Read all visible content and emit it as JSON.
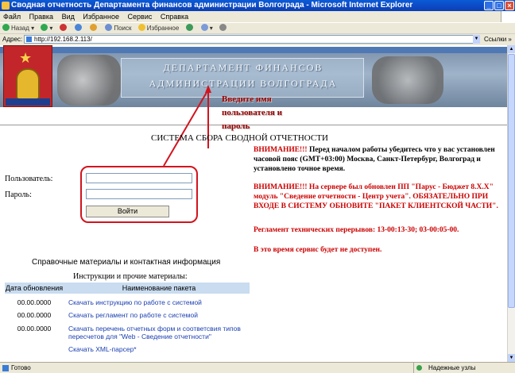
{
  "window": {
    "title": "Сводная отчетность Департамента финансов администрации Волгограда - Microsoft Internet Explorer"
  },
  "menu": [
    "Файл",
    "Правка",
    "Вид",
    "Избранное",
    "Сервис",
    "Справка"
  ],
  "toolbar": {
    "back": "Назад",
    "search": "Поиск",
    "favorites": "Избранное"
  },
  "address": {
    "label": "Адрес:",
    "url": "http://192.168.2.113/",
    "links": "Ссылки"
  },
  "banner": {
    "line1": "ДЕПАРТАМЕНТ ФИНАНСОВ",
    "line2": "АДМИНИСТРАЦИИ ВОЛГОГРАДА"
  },
  "callout": "Введите имя пользователя и пароль",
  "system_title": "СИСТЕМА СБОРА СВОДНОЙ ОТЧЕТНОСТИ",
  "login": {
    "user_label": "Пользователь:",
    "pass_label": "Пароль:",
    "user_value": "",
    "pass_value": "",
    "submit": "Войти"
  },
  "notices": {
    "n1_prefix": "ВНИМАНИЕ!!!",
    "n1_text": " Перед началом работы убедитесь что у вас установлен часовой пояс (GMT+03:00) Москва, Санкт-Петербург, Волгоград и установлено точное время.",
    "n2": "ВНИМАНИЕ!!! На сервере был обновлен ПП \"Парус - Бюджет 8.Х.Х\" модуль \"Сведение отчетности - Центр учета\". ОБЯЗАТЕЛЬНО ПРИ ВХОДЕ В СИСТЕМУ ОБНОВИТЕ \"ПАКЕТ КЛИЕНТСКОЙ ЧАСТИ\".",
    "n3": "Регламент технических перерывов: 13-00:13-30; 03-00:05-00.",
    "n4": "В это время сервис будет не доступен."
  },
  "reference": {
    "heading": "Справочные материалы и контактная информация",
    "instructions": "Инструкции и прочие материалы:",
    "columns": [
      "Дата обновления",
      "Наименование пакета"
    ],
    "rows": [
      {
        "date": "00.00.0000",
        "name": "Скачать инструкцию по работе с системой"
      },
      {
        "date": "00.00.0000",
        "name": "Скачать регламент по работе с системой"
      },
      {
        "date": "00.00.0000",
        "name": "Скачать перечень отчетных форм и соответсвия типов пересчетов для \"Web - Сведение отчетности\""
      },
      {
        "date": "",
        "name": "Скачать XML-парсер*"
      }
    ]
  },
  "status": {
    "text": "Готово",
    "zone": "Надежные узлы"
  }
}
